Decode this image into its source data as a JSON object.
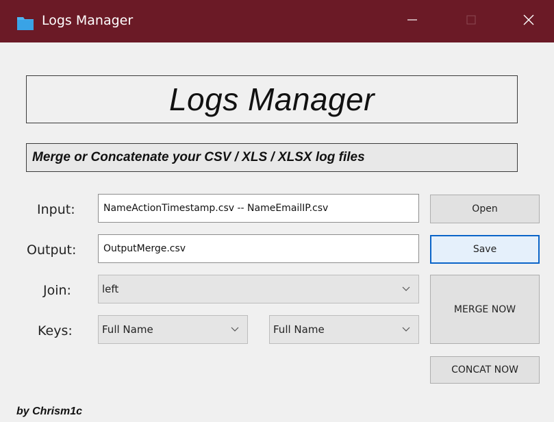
{
  "window": {
    "title": "Logs Manager",
    "titlebar_color": "#6b1a26",
    "icons": {
      "app": "folder-icon",
      "minimize": "minimize-icon",
      "maximize": "maximize-icon",
      "close": "close-icon"
    }
  },
  "header": {
    "title": "Logs Manager"
  },
  "subtitle": {
    "text": "Merge or Concatenate your CSV / XLS / XLSX log files"
  },
  "form": {
    "input": {
      "label": "Input:",
      "value": "NameActionTimestamp.csv -- NameEmailIP.csv"
    },
    "output": {
      "label": "Output:",
      "value": "OutputMerge.csv"
    },
    "join": {
      "label": "Join:",
      "value": "left"
    },
    "keys": {
      "label": "Keys:",
      "left_value": "Full Name",
      "right_value": "Full Name"
    }
  },
  "buttons": {
    "open": "Open",
    "save": "Save",
    "merge": "MERGE NOW",
    "concat": "CONCAT NOW"
  },
  "footer": {
    "credit": "by Chrism1c"
  },
  "colors": {
    "focus_accent": "#0a64c8"
  }
}
